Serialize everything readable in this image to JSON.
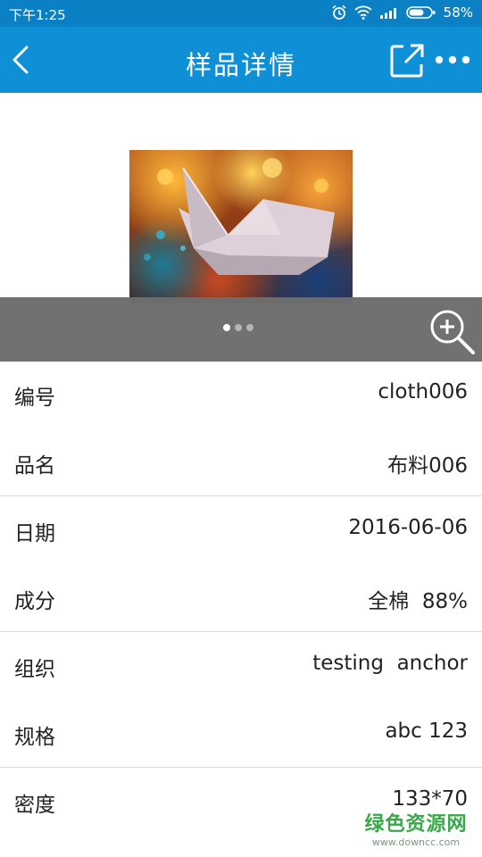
{
  "status_bar": {
    "time": "下午1:25",
    "battery": "58%",
    "icons": [
      "alarm-icon",
      "wifi-icon",
      "signal-icon",
      "battery-icon"
    ]
  },
  "header": {
    "title": "样品详情",
    "icons": [
      "back-icon",
      "share-icon",
      "more-icon"
    ]
  },
  "gallery": {
    "page_count": 3,
    "active_page": 1,
    "icons": [
      "zoom-in-icon"
    ]
  },
  "details": [
    {
      "label": "编号",
      "value": "cloth006"
    },
    {
      "label": "品名",
      "value": "布料006"
    },
    {
      "label": "日期",
      "value": "2016-06-06"
    },
    {
      "label": "成分",
      "value": "全棉  88%"
    },
    {
      "label": "组织",
      "value": "testing  anchor"
    },
    {
      "label": "规格",
      "value": "abc 123"
    },
    {
      "label": "密度",
      "value": "133*70"
    }
  ],
  "watermark": {
    "title": "绿色资源网",
    "url": "www.downcc.com"
  },
  "colors": {
    "status_bar": "#0b80c4",
    "app_bar": "#0e8fd6",
    "gallery_bar": "#6e6e6e",
    "watermark": "#3aa84a"
  }
}
